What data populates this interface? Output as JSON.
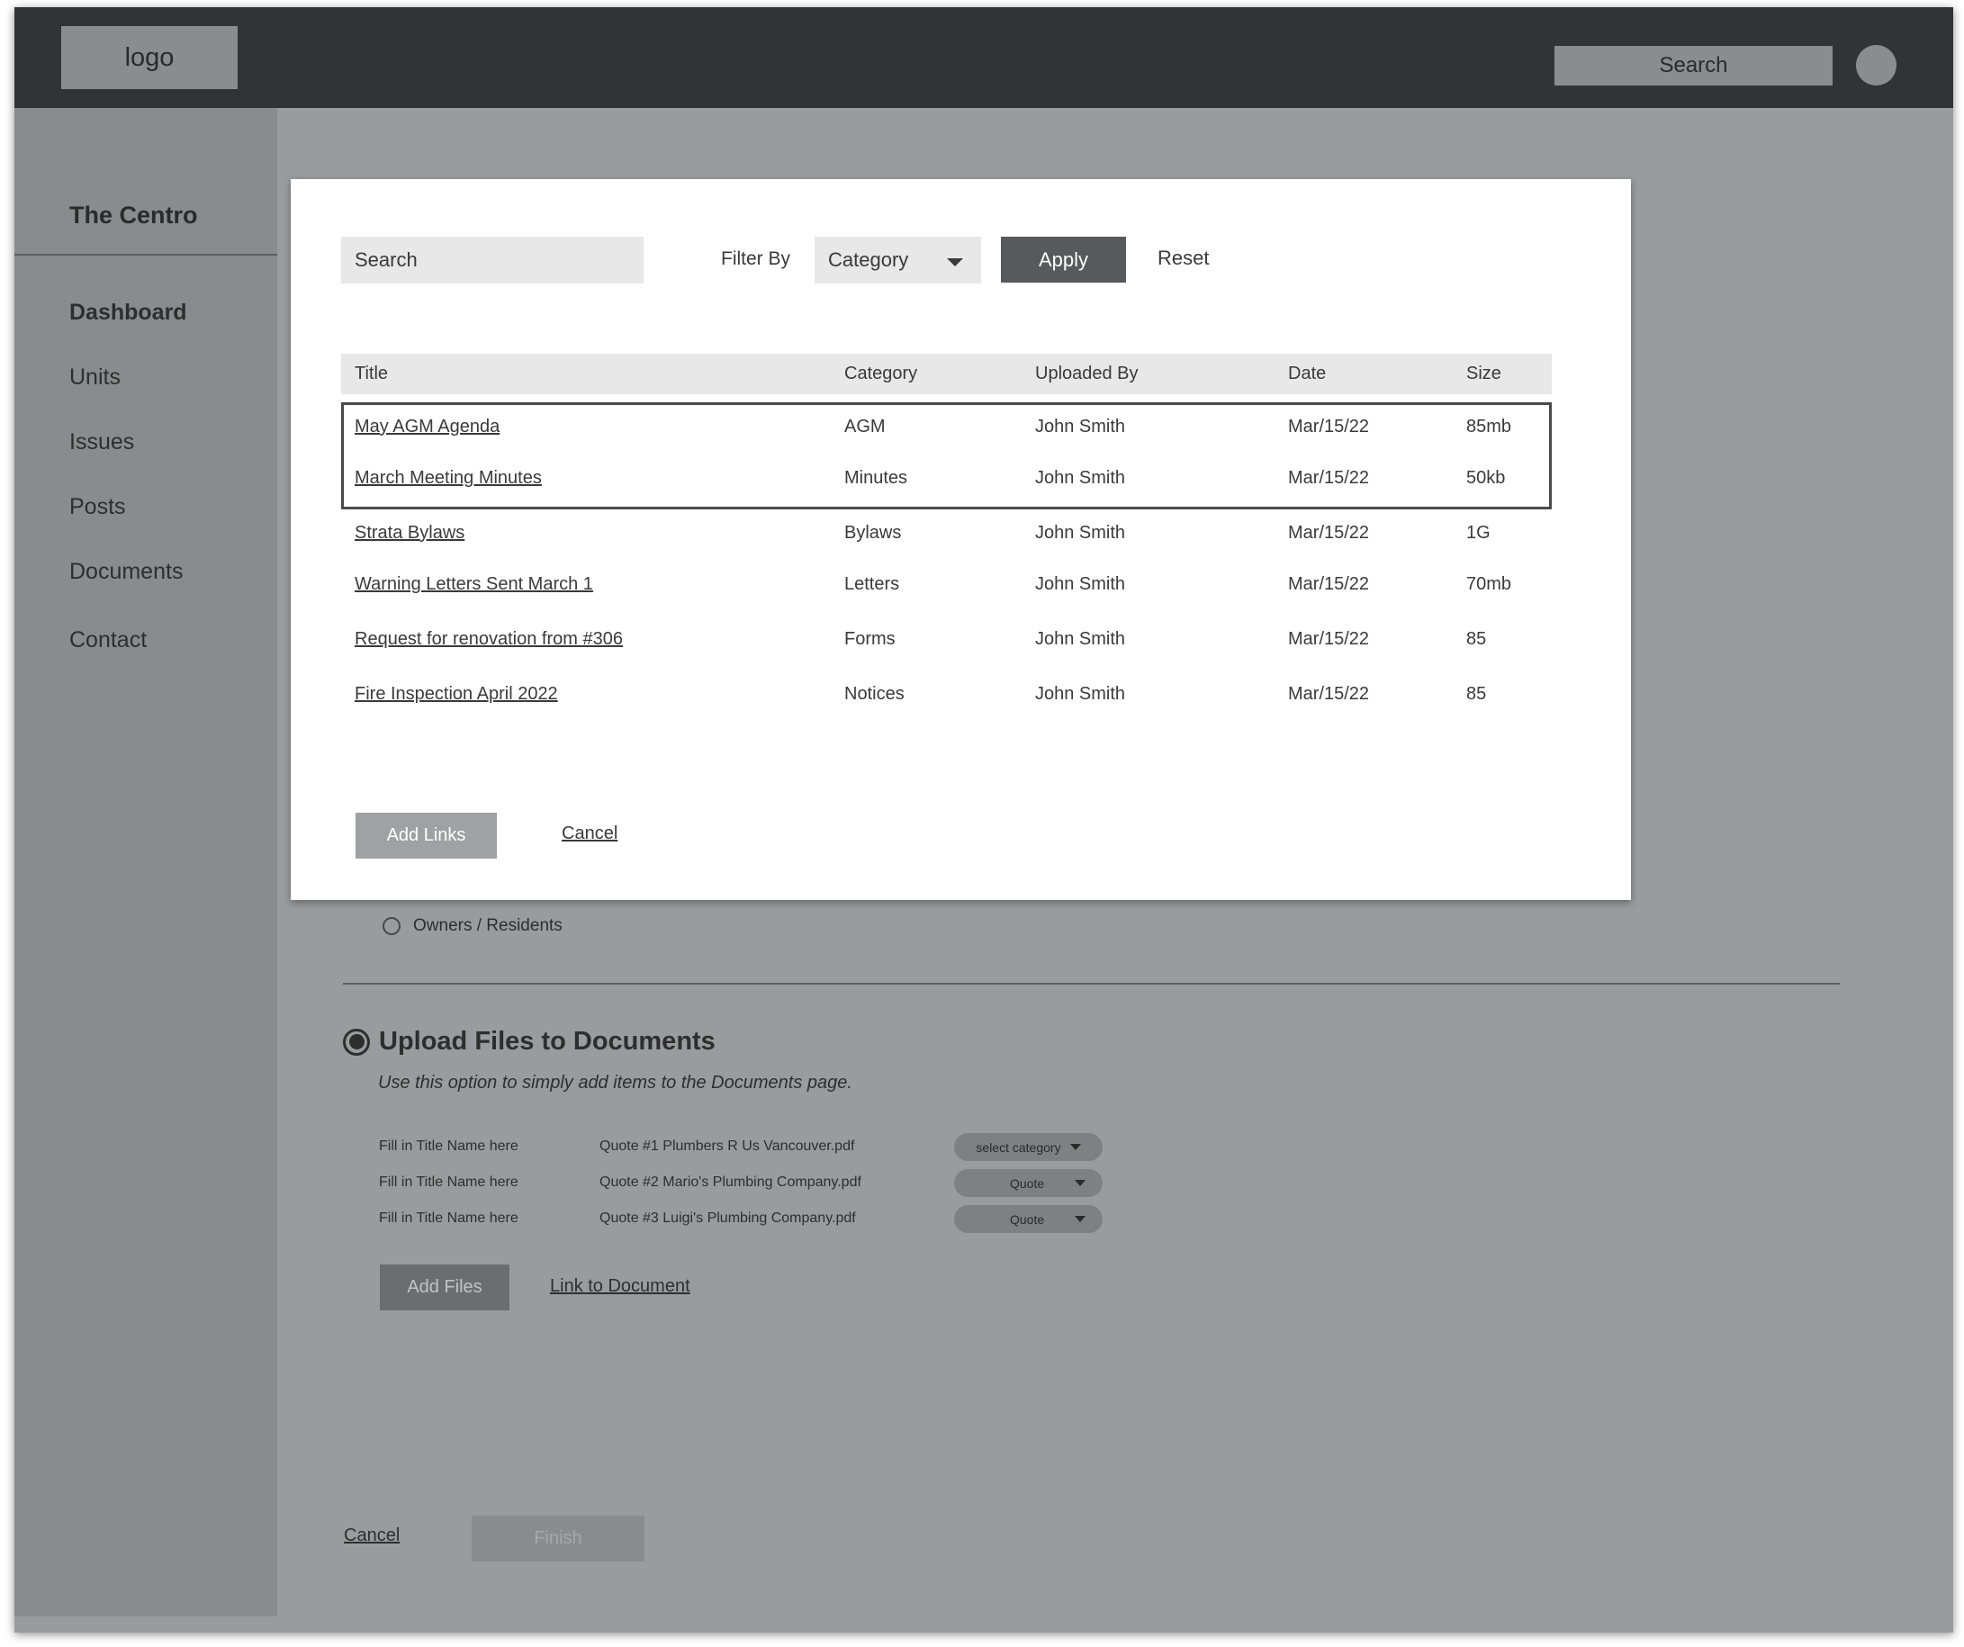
{
  "header": {
    "logo": "logo",
    "search_label": "Search"
  },
  "sidebar": {
    "title": "The Centro",
    "items": [
      {
        "label": "Dashboard"
      },
      {
        "label": "Units"
      },
      {
        "label": "Issues"
      },
      {
        "label": "Posts"
      },
      {
        "label": "Documents"
      },
      {
        "label": "Contact"
      }
    ]
  },
  "background": {
    "audience_option": "Owners / Residents",
    "upload": {
      "title": "Upload Files to Documents",
      "description": "Use this option to simply add items to the Documents page.",
      "files": [
        {
          "title_placeholder": "Fill in Title Name here",
          "file_name": "Quote #1 Plumbers R Us Vancouver.pdf",
          "category": "select category"
        },
        {
          "title_placeholder": "Fill in Title Name here",
          "file_name": "Quote #2 Mario's Plumbing Company.pdf",
          "category": "Quote"
        },
        {
          "title_placeholder": "Fill in Title Name here",
          "file_name": "Quote #3 Luigi's Plumbing Company.pdf",
          "category": "Quote"
        }
      ],
      "add_files_label": "Add Files",
      "link_label": "Link to Document"
    },
    "cancel_label": "Cancel",
    "finish_label": "Finish"
  },
  "modal": {
    "search_placeholder": "Search",
    "filter_label": "Filter By",
    "filter_value": "Category",
    "apply_label": "Apply",
    "reset_label": "Reset",
    "columns": [
      "Title",
      "Category",
      "Uploaded By",
      "Date",
      "Size"
    ],
    "rows": [
      {
        "title": "May AGM Agenda",
        "category": "AGM",
        "uploaded_by": "John Smith",
        "date": "Mar/15/22",
        "size": "85mb",
        "selected": true
      },
      {
        "title": "March Meeting Minutes",
        "category": "Minutes",
        "uploaded_by": "John Smith",
        "date": "Mar/15/22",
        "size": "50kb",
        "selected": true
      },
      {
        "title": "Strata Bylaws",
        "category": "Bylaws",
        "uploaded_by": "John Smith",
        "date": "Mar/15/22",
        "size": "1G",
        "selected": false
      },
      {
        "title": "Warning Letters Sent March 1",
        "category": "Letters",
        "uploaded_by": "John Smith",
        "date": "Mar/15/22",
        "size": "70mb",
        "selected": false
      },
      {
        "title": "Request for renovation from #306",
        "category": "Forms",
        "uploaded_by": "John Smith",
        "date": "Mar/15/22",
        "size": "85",
        "selected": false
      },
      {
        "title": "Fire Inspection April 2022",
        "category": "Notices",
        "uploaded_by": "John Smith",
        "date": "Mar/15/22",
        "size": "85",
        "selected": false
      }
    ],
    "add_links_label": "Add Links",
    "cancel_label": "Cancel"
  }
}
